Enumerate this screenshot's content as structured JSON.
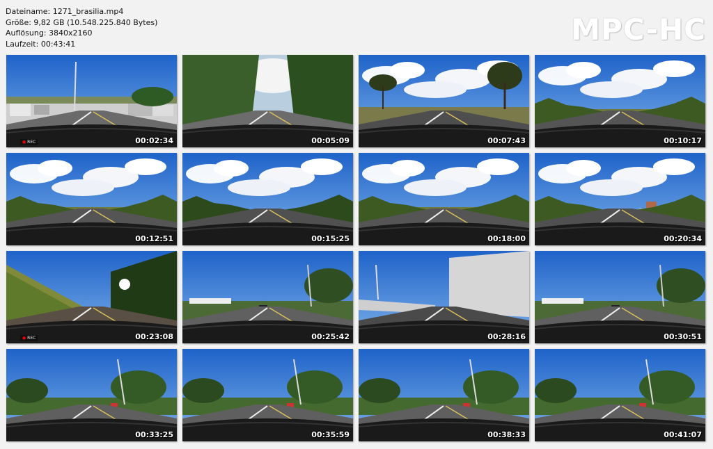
{
  "info": {
    "filename": "Dateiname: 1271_brasilia.mp4",
    "size": "Größe: 9,82 GB (10.548.225.840 Bytes)",
    "resolution": "Auflösung: 3840x2160",
    "duration": "Laufzeit: 00:43:41"
  },
  "logo": "MPC-HC",
  "thumbnails": [
    {
      "time": "00:02:34",
      "scene": "parking"
    },
    {
      "time": "00:05:09",
      "scene": "forest-road"
    },
    {
      "time": "00:07:43",
      "scene": "road-trees"
    },
    {
      "time": "00:10:17",
      "scene": "road-clouds"
    },
    {
      "time": "00:12:51",
      "scene": "road-clouds"
    },
    {
      "time": "00:15:25",
      "scene": "road-forest"
    },
    {
      "time": "00:18:00",
      "scene": "road-clouds"
    },
    {
      "time": "00:20:34",
      "scene": "road-dirt"
    },
    {
      "time": "00:23:08",
      "scene": "hill-road"
    },
    {
      "time": "00:25:42",
      "scene": "city"
    },
    {
      "time": "00:28:16",
      "scene": "wall"
    },
    {
      "time": "00:30:51",
      "scene": "city"
    },
    {
      "time": "00:33:25",
      "scene": "avenue"
    },
    {
      "time": "00:35:59",
      "scene": "avenue"
    },
    {
      "time": "00:38:33",
      "scene": "avenue"
    },
    {
      "time": "00:41:07",
      "scene": "avenue"
    }
  ],
  "rec_label": "REC"
}
